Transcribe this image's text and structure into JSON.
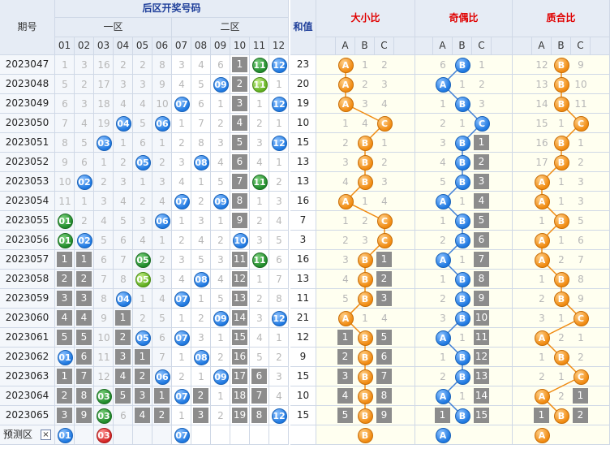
{
  "headers": {
    "period": "期号",
    "back_title": "后区开奖号码",
    "zone1": "一区",
    "zone2": "二区",
    "sum": "和值",
    "big_small": "大小比",
    "odd_even": "奇偶比",
    "prime_comp": "质合比",
    "number_cols": [
      "01",
      "02",
      "03",
      "04",
      "05",
      "06",
      "07",
      "08",
      "09",
      "10",
      "11",
      "12"
    ],
    "abc": [
      "A",
      "B",
      "C"
    ]
  },
  "colors": {
    "header_bg": "#e6ecf5",
    "ball_blue": "#1e78e0",
    "ball_green": "#1f8a2a",
    "ball_lime": "#5fae1f",
    "ball_red": "#d42424",
    "ball_orange": "#f08a10",
    "gray_square": "#8c8c8c",
    "line_orange": "#f08a10",
    "line_blue": "#3f7fd6"
  },
  "rows": [
    {
      "period": "2023047",
      "cells": [
        "1",
        "3",
        "16",
        "2",
        "2",
        "8",
        "3",
        "4",
        "6",
        "1",
        "11",
        "12"
      ],
      "sum": "23",
      "bs": [
        "A",
        "1",
        "2"
      ],
      "oe": [
        "6",
        "B",
        "1"
      ],
      "pc": [
        "12",
        "B",
        "9"
      ]
    },
    {
      "period": "2023048",
      "cells": [
        "5",
        "2",
        "17",
        "3",
        "3",
        "9",
        "4",
        "5",
        "09",
        "2",
        "11",
        "1"
      ],
      "sum": "20",
      "bs": [
        "A",
        "2",
        "3"
      ],
      "oe": [
        "A",
        "1",
        "2"
      ],
      "pc": [
        "13",
        "B",
        "10"
      ]
    },
    {
      "period": "2023049",
      "cells": [
        "6",
        "3",
        "18",
        "4",
        "4",
        "10",
        "07",
        "6",
        "1",
        "3",
        "1",
        "12"
      ],
      "sum": "19",
      "bs": [
        "A",
        "3",
        "4"
      ],
      "oe": [
        "1",
        "B",
        "3"
      ],
      "pc": [
        "14",
        "B",
        "11"
      ]
    },
    {
      "period": "2023050",
      "cells": [
        "7",
        "4",
        "19",
        "04",
        "5",
        "06",
        "1",
        "7",
        "2",
        "4",
        "2",
        "1"
      ],
      "sum": "10",
      "bs": [
        "1",
        "4",
        "C"
      ],
      "oe": [
        "2",
        "1",
        "C"
      ],
      "pc": [
        "15",
        "1",
        "C"
      ]
    },
    {
      "period": "2023051",
      "cells": [
        "8",
        "5",
        "03",
        "1",
        "6",
        "1",
        "2",
        "8",
        "3",
        "5",
        "3",
        "12"
      ],
      "sum": "15",
      "bs": [
        "2",
        "B",
        "1"
      ],
      "oe": [
        "3",
        "B",
        "1"
      ],
      "pc": [
        "16",
        "B",
        "1"
      ]
    },
    {
      "period": "2023052",
      "cells": [
        "9",
        "6",
        "1",
        "2",
        "05",
        "2",
        "3",
        "08",
        "4",
        "6",
        "4",
        "1"
      ],
      "sum": "13",
      "bs": [
        "3",
        "B",
        "2"
      ],
      "oe": [
        "4",
        "B",
        "2"
      ],
      "pc": [
        "17",
        "B",
        "2"
      ]
    },
    {
      "period": "2023053",
      "cells": [
        "10",
        "02",
        "2",
        "3",
        "1",
        "3",
        "4",
        "1",
        "5",
        "7",
        "11",
        "2"
      ],
      "sum": "13",
      "bs": [
        "4",
        "B",
        "3"
      ],
      "oe": [
        "5",
        "B",
        "3"
      ],
      "pc": [
        "A",
        "1",
        "3"
      ]
    },
    {
      "period": "2023054",
      "cells": [
        "11",
        "1",
        "3",
        "4",
        "2",
        "4",
        "07",
        "2",
        "09",
        "8",
        "1",
        "3"
      ],
      "sum": "16",
      "bs": [
        "A",
        "1",
        "4"
      ],
      "oe": [
        "A",
        "1",
        "4"
      ],
      "pc": [
        "A",
        "1",
        "3"
      ]
    },
    {
      "period": "2023055",
      "cells": [
        "01",
        "2",
        "4",
        "5",
        "3",
        "06",
        "1",
        "3",
        "1",
        "9",
        "2",
        "4"
      ],
      "sum": "7",
      "bs": [
        "1",
        "2",
        "C"
      ],
      "oe": [
        "1",
        "B",
        "5"
      ],
      "pc": [
        "1",
        "B",
        "5"
      ]
    },
    {
      "period": "2023056",
      "cells": [
        "01",
        "02",
        "5",
        "6",
        "4",
        "1",
        "2",
        "4",
        "2",
        "10",
        "3",
        "5"
      ],
      "sum": "3",
      "bs": [
        "2",
        "3",
        "C"
      ],
      "oe": [
        "2",
        "B",
        "6"
      ],
      "pc": [
        "A",
        "1",
        "6"
      ]
    },
    {
      "period": "2023057",
      "cells": [
        "1",
        "1",
        "6",
        "7",
        "05",
        "2",
        "3",
        "5",
        "3",
        "11",
        "11",
        "6"
      ],
      "sum": "16",
      "bs": [
        "3",
        "B",
        "1"
      ],
      "oe": [
        "A",
        "1",
        "7"
      ],
      "pc": [
        "A",
        "2",
        "7"
      ]
    },
    {
      "period": "2023058",
      "cells": [
        "2",
        "2",
        "7",
        "8",
        "05",
        "3",
        "4",
        "08",
        "4",
        "12",
        "1",
        "7"
      ],
      "sum": "13",
      "bs": [
        "4",
        "B",
        "2"
      ],
      "oe": [
        "1",
        "B",
        "8"
      ],
      "pc": [
        "1",
        "B",
        "8"
      ]
    },
    {
      "period": "2023059",
      "cells": [
        "3",
        "3",
        "8",
        "04",
        "1",
        "4",
        "07",
        "1",
        "5",
        "13",
        "2",
        "8"
      ],
      "sum": "11",
      "bs": [
        "5",
        "B",
        "3"
      ],
      "oe": [
        "2",
        "B",
        "9"
      ],
      "pc": [
        "2",
        "B",
        "9"
      ]
    },
    {
      "period": "2023060",
      "cells": [
        "4",
        "4",
        "9",
        "1",
        "2",
        "5",
        "1",
        "2",
        "09",
        "14",
        "3",
        "12"
      ],
      "sum": "21",
      "bs": [
        "A",
        "1",
        "4"
      ],
      "oe": [
        "3",
        "B",
        "10"
      ],
      "pc": [
        "3",
        "1",
        "C"
      ]
    },
    {
      "period": "2023061",
      "cells": [
        "5",
        "5",
        "10",
        "2",
        "05",
        "6",
        "07",
        "3",
        "1",
        "15",
        "4",
        "1"
      ],
      "sum": "12",
      "bs": [
        "1",
        "B",
        "5"
      ],
      "oe": [
        "A",
        "1",
        "11"
      ],
      "pc": [
        "A",
        "2",
        "1"
      ]
    },
    {
      "period": "2023062",
      "cells": [
        "01",
        "6",
        "11",
        "3",
        "1",
        "7",
        "1",
        "08",
        "2",
        "16",
        "5",
        "2"
      ],
      "sum": "9",
      "bs": [
        "2",
        "B",
        "6"
      ],
      "oe": [
        "1",
        "B",
        "12"
      ],
      "pc": [
        "1",
        "B",
        "2"
      ]
    },
    {
      "period": "2023063",
      "cells": [
        "1",
        "7",
        "12",
        "4",
        "2",
        "06",
        "2",
        "1",
        "09",
        "17",
        "6",
        "3"
      ],
      "sum": "15",
      "bs": [
        "3",
        "B",
        "7"
      ],
      "oe": [
        "2",
        "B",
        "13"
      ],
      "pc": [
        "2",
        "1",
        "C"
      ]
    },
    {
      "period": "2023064",
      "cells": [
        "2",
        "8",
        "03",
        "5",
        "3",
        "1",
        "07",
        "2",
        "1",
        "18",
        "7",
        "4"
      ],
      "sum": "10",
      "bs": [
        "4",
        "B",
        "8"
      ],
      "oe": [
        "A",
        "1",
        "14"
      ],
      "pc": [
        "A",
        "2",
        "1"
      ]
    },
    {
      "period": "2023065",
      "cells": [
        "3",
        "9",
        "03",
        "6",
        "4",
        "2",
        "1",
        "3",
        "2",
        "19",
        "8",
        "12"
      ],
      "sum": "15",
      "bs": [
        "5",
        "B",
        "9"
      ],
      "oe": [
        "1",
        "B",
        "15"
      ],
      "pc": [
        "1",
        "B",
        "2"
      ]
    }
  ],
  "predict": {
    "label": "预测区",
    "check": "×",
    "balls": [
      {
        "col": 0,
        "text": "01",
        "color": "blue"
      },
      {
        "col": 2,
        "text": "03",
        "color": "red"
      },
      {
        "col": 6,
        "text": "07",
        "color": "blue"
      }
    ],
    "bs": {
      "col": 1,
      "text": "B"
    },
    "oe": {
      "col": 0,
      "text": "A"
    },
    "pc": {
      "col": 0,
      "text": "A"
    }
  }
}
